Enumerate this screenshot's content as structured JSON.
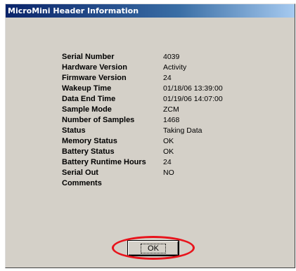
{
  "window": {
    "title": "MicroMini Header Information"
  },
  "info": {
    "rows": [
      {
        "label": "Serial Number",
        "value": "4039"
      },
      {
        "label": "Hardware Version",
        "value": "Activity"
      },
      {
        "label": "Firmware Version",
        "value": "24"
      },
      {
        "label": "Wakeup Time",
        "value": "01/18/06 13:39:00"
      },
      {
        "label": "Data End Time",
        "value": "01/19/06 14:07:00"
      },
      {
        "label": "Sample Mode",
        "value": "ZCM"
      },
      {
        "label": "Number of Samples",
        "value": "1468"
      },
      {
        "label": "Status",
        "value": "Taking Data"
      },
      {
        "label": "Memory Status",
        "value": "OK"
      },
      {
        "label": "Battery Status",
        "value": "OK"
      },
      {
        "label": "Battery Runtime Hours",
        "value": "24"
      },
      {
        "label": "Serial Out",
        "value": "NO"
      },
      {
        "label": "Comments",
        "value": ""
      }
    ]
  },
  "buttons": {
    "ok_label": "OK"
  },
  "colors": {
    "titlebar_start": "#0a246a",
    "titlebar_end": "#a6caf0",
    "window_bg": "#d4d0c8",
    "highlight": "#e8141c"
  }
}
